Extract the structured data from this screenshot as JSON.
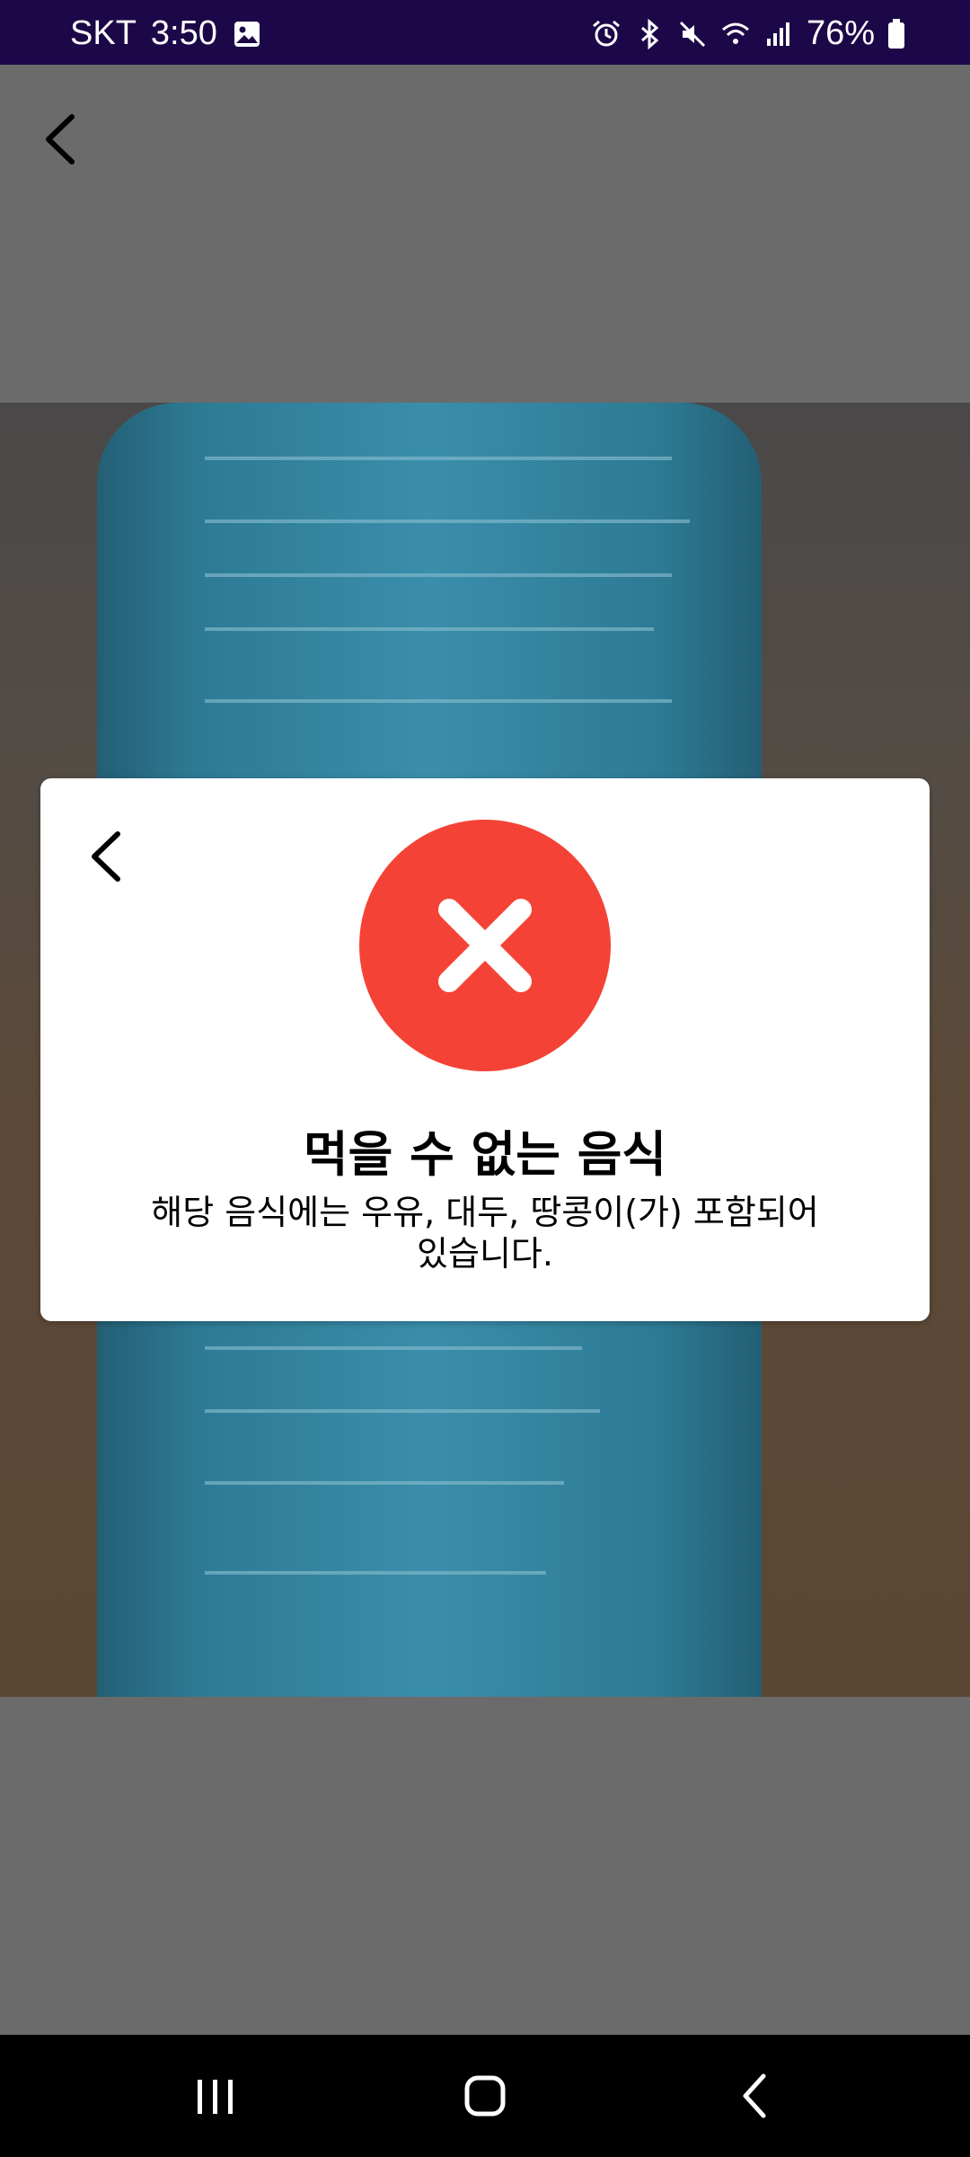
{
  "status_bar": {
    "carrier": "SKT",
    "time": "3:50",
    "battery": "76%",
    "icons": [
      "gallery-icon",
      "alarm-icon",
      "bluetooth-icon",
      "mute-icon",
      "wifi-icon",
      "signal-icon",
      "battery-icon"
    ],
    "background": "#1c0848"
  },
  "result_dialog": {
    "status_icon": "close-icon",
    "status_color": "#f44336",
    "title": "먹을 수 없는 음식",
    "message": "해당 음식에는 우유, 대두, 땅콩이(가) 포함되어 있습니다."
  },
  "navigation_bar": {
    "buttons": [
      "recent-apps-icon",
      "home-icon",
      "back-icon"
    ]
  }
}
